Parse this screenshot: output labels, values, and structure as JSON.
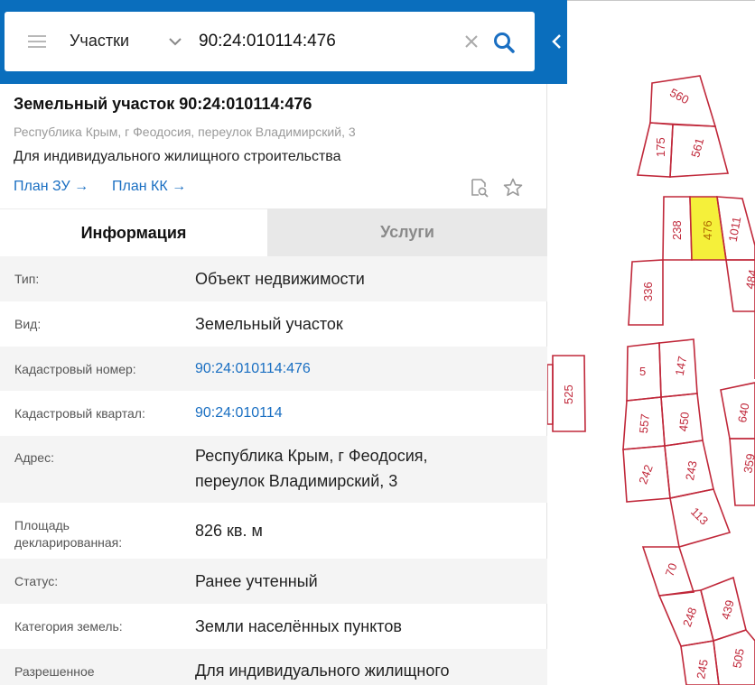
{
  "header": {
    "category": "Участки",
    "search_value": "90:24:010114:476"
  },
  "parcel": {
    "title": "Земельный участок 90:24:010114:476",
    "address": "Республика Крым, г Феодосия, переулок Владимирский, 3",
    "use": "Для индивидуального жилищного строительства",
    "plan_zu": "План ЗУ →",
    "plan_kk": "План КК →"
  },
  "tabs": {
    "info": "Информация",
    "services": "Услуги"
  },
  "rows": [
    {
      "label": "Тип:",
      "value": "Объект недвижимости"
    },
    {
      "label": "Вид:",
      "value": "Земельный участок"
    },
    {
      "label": "Кадастровый номер:",
      "value": "90:24:010114:476"
    },
    {
      "label": "Кадастровый квартал:",
      "value": "90:24:010114"
    },
    {
      "label": "Адрес:",
      "value": "Республика Крым, г Феодосия,",
      "value2": "переулок Владимирский, 3"
    },
    {
      "label": "Площадь",
      "label2": "декларированная:",
      "value": "826 кв. м"
    },
    {
      "label": "Статус:",
      "value": "Ранее учтенный"
    },
    {
      "label": "Категория земель:",
      "value": "Земли населённых пунктов"
    },
    {
      "label": "Разрешенное",
      "value": "Для индивидуального жилищного"
    }
  ],
  "map": {
    "parcel_numbers": [
      "560",
      "175",
      "561",
      "238",
      "476",
      "1011",
      "336",
      "484",
      "525",
      "5",
      "147",
      "557",
      "450",
      "640",
      "242",
      "243",
      "359",
      "113",
      "70",
      "439",
      "248",
      "505",
      "245"
    ],
    "highlight_color": "#f5f03a",
    "boundary_color": "#c0283a"
  }
}
